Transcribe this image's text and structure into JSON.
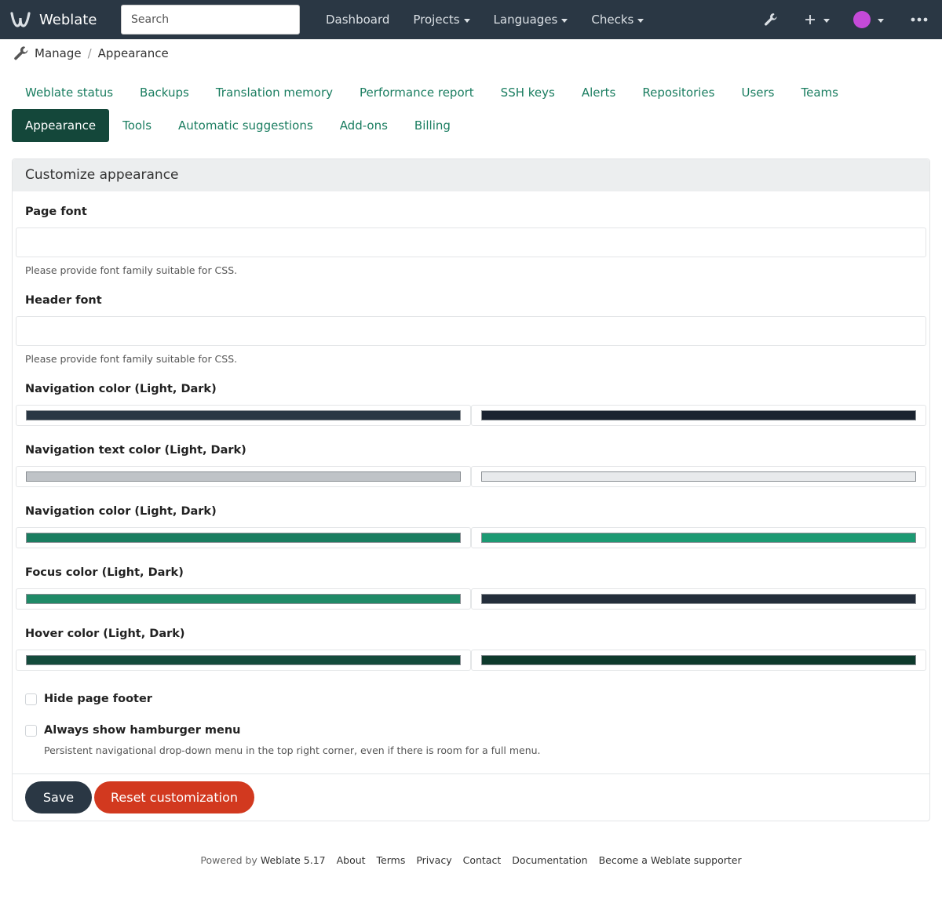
{
  "navbar": {
    "brand": "Weblate",
    "search_placeholder": "Search",
    "menu": [
      {
        "label": "Dashboard",
        "dropdown": false
      },
      {
        "label": "Projects",
        "dropdown": true
      },
      {
        "label": "Languages",
        "dropdown": true
      },
      {
        "label": "Checks",
        "dropdown": true
      }
    ],
    "icons": [
      "wrench-icon",
      "plus-icon",
      "avatar",
      "more-icon"
    ],
    "bg_color": "#2a3744"
  },
  "breadcrumb": {
    "items": [
      "Manage",
      "Appearance"
    ],
    "separator": "/"
  },
  "tabs": [
    {
      "label": "Weblate status",
      "active": false
    },
    {
      "label": "Backups",
      "active": false
    },
    {
      "label": "Translation memory",
      "active": false
    },
    {
      "label": "Performance report",
      "active": false
    },
    {
      "label": "SSH keys",
      "active": false
    },
    {
      "label": "Alerts",
      "active": false
    },
    {
      "label": "Repositories",
      "active": false
    },
    {
      "label": "Users",
      "active": false
    },
    {
      "label": "Teams",
      "active": false
    },
    {
      "label": "Appearance",
      "active": true
    },
    {
      "label": "Tools",
      "active": false
    },
    {
      "label": "Automatic suggestions",
      "active": false
    },
    {
      "label": "Add-ons",
      "active": false
    },
    {
      "label": "Billing",
      "active": false
    }
  ],
  "panel": {
    "title": "Customize appearance",
    "page_font": {
      "label": "Page font",
      "value": "",
      "help": "Please provide font family suitable for CSS."
    },
    "header_font": {
      "label": "Header font",
      "value": "",
      "help": "Please provide font family suitable for CSS."
    },
    "colors": [
      {
        "label": "Navigation color (Light, Dark)",
        "light": "#2a3744",
        "dark": "#1a2330"
      },
      {
        "label": "Navigation text color (Light, Dark)",
        "light": "#bfc3c7",
        "dark": "#e8eaec"
      },
      {
        "label": "Navigation color (Light, Dark)",
        "light": "#1a7d60",
        "dark": "#1c9a73"
      },
      {
        "label": "Focus color (Light, Dark)",
        "light": "#1f8a67",
        "dark": "#242e3b"
      },
      {
        "label": "Hover color (Light, Dark)",
        "light": "#144b3c",
        "dark": "#0e3a2c"
      }
    ],
    "hide_footer": {
      "label": "Hide page footer",
      "checked": false
    },
    "hamburger": {
      "label": "Always show hamburger menu",
      "checked": false,
      "help": "Persistent navigational drop-down menu in the top right corner, even if there is room for a full menu."
    },
    "save_label": "Save",
    "reset_label": "Reset customization"
  },
  "footer": {
    "powered_prefix": "Powered by",
    "powered_link": "Weblate 5.17",
    "links": [
      "About",
      "Terms",
      "Privacy",
      "Contact",
      "Documentation",
      "Become a Weblate supporter"
    ]
  }
}
